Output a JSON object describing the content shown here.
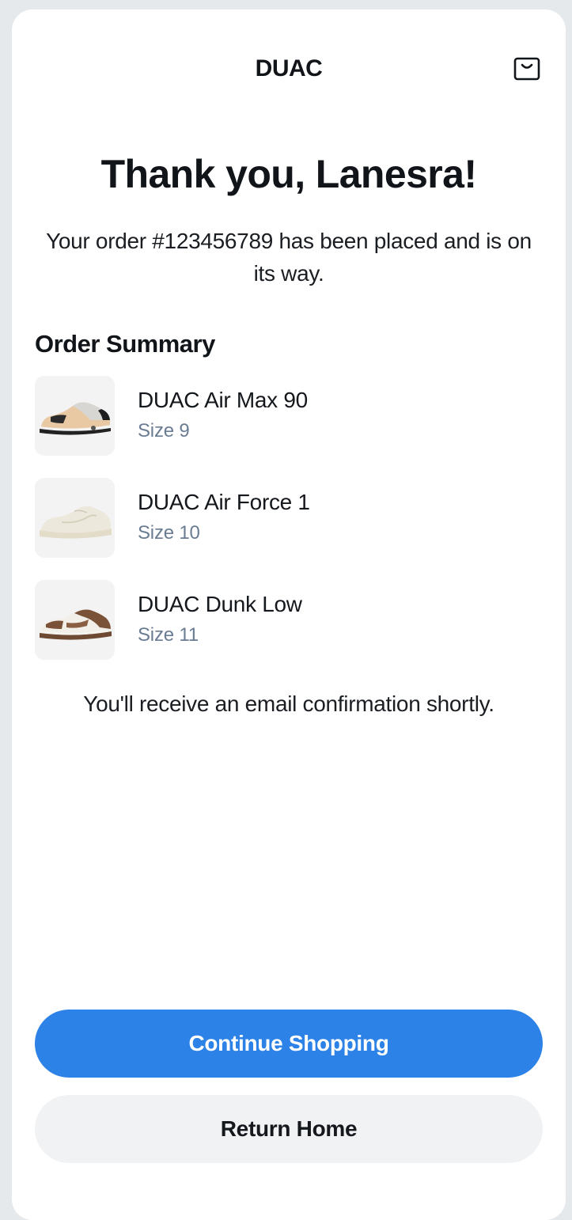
{
  "header": {
    "brand": "DUAC",
    "cart_icon": "shopping-bag-icon"
  },
  "confirmation": {
    "title": "Thank you, Lanesra!",
    "message": "Your order #123456789 has been placed and is on its way."
  },
  "order_summary": {
    "heading": "Order Summary",
    "items": [
      {
        "name": "DUAC Air Max 90",
        "size": "Size 9",
        "image": "air-max-90-sneaker-image"
      },
      {
        "name": "DUAC Air Force 1",
        "size": "Size 10",
        "image": "air-force-1-sneaker-image"
      },
      {
        "name": "DUAC Dunk Low",
        "size": "Size 11",
        "image": "dunk-low-sneaker-image"
      }
    ]
  },
  "email_note": "You'll receive an email confirmation shortly.",
  "actions": {
    "continue_label": "Continue Shopping",
    "home_label": "Return Home"
  },
  "colors": {
    "primary": "#2d82e8",
    "secondary_button": "#f1f2f4",
    "muted_text": "#6a7c92",
    "page_background": "#e6e9ec"
  }
}
